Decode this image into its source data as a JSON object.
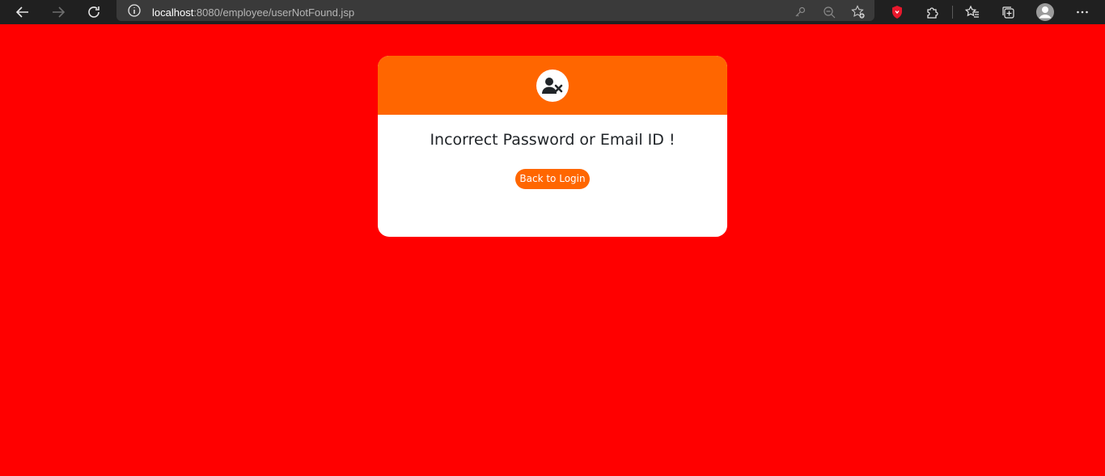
{
  "browser": {
    "url_host": "localhost",
    "url_path": ":8080/employee/userNotFound.jsp",
    "icons": [
      "back-icon",
      "forward-icon",
      "refresh-icon",
      "info-icon",
      "key-icon",
      "zoom-out-icon",
      "favorite-add-icon",
      "shield-icon",
      "extensions-icon",
      "favorites-icon",
      "collections-icon",
      "profile-icon",
      "more-icon"
    ]
  },
  "page": {
    "background_color": "#ff0000",
    "accent_color": "#ff6600",
    "header_icon": "user-x-icon",
    "message": "Incorrect Password or Email ID !",
    "back_button_label": "Back to Login"
  }
}
